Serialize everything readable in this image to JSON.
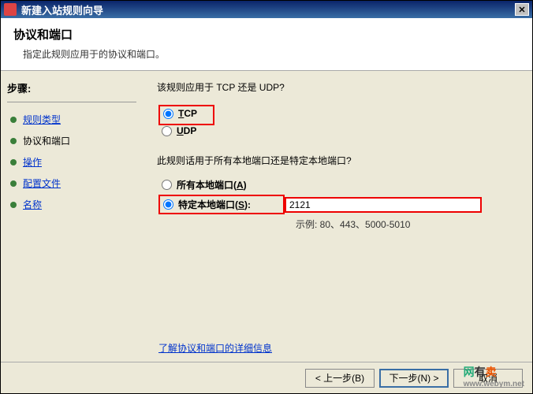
{
  "titlebar": {
    "title": "新建入站规则向导"
  },
  "header": {
    "title": "协议和端口",
    "desc": "指定此规则应用于的协议和端口。"
  },
  "sidebar": {
    "heading": "步骤:",
    "items": [
      {
        "label": "规则类型"
      },
      {
        "label": "协议和端口"
      },
      {
        "label": "操作"
      },
      {
        "label": "配置文件"
      },
      {
        "label": "名称"
      }
    ]
  },
  "main": {
    "q1": "该规则应用于 TCP 还是 UDP?",
    "tcp_prefix": "T",
    "tcp_rest": "CP",
    "udp_prefix": "U",
    "udp_rest": "DP",
    "q2": "此规则话用于所有本地端口还是特定本地端口?",
    "all_ports": "所有本地端口(",
    "all_key": "A",
    "all_close": ")",
    "specific_ports": "特定本地端口(",
    "spec_key": "S",
    "spec_close": "):",
    "port_value": "2121",
    "example": "示例: 80、443、5000-5010",
    "help_link": "了解协议和端口的详细信息"
  },
  "footer": {
    "back": "< 上一步(B)",
    "next": "下一步(N) >",
    "cancel": "取消"
  },
  "watermark": {
    "a": "网",
    "b": "有",
    "c": "卖",
    "url": "www.webym.net"
  }
}
